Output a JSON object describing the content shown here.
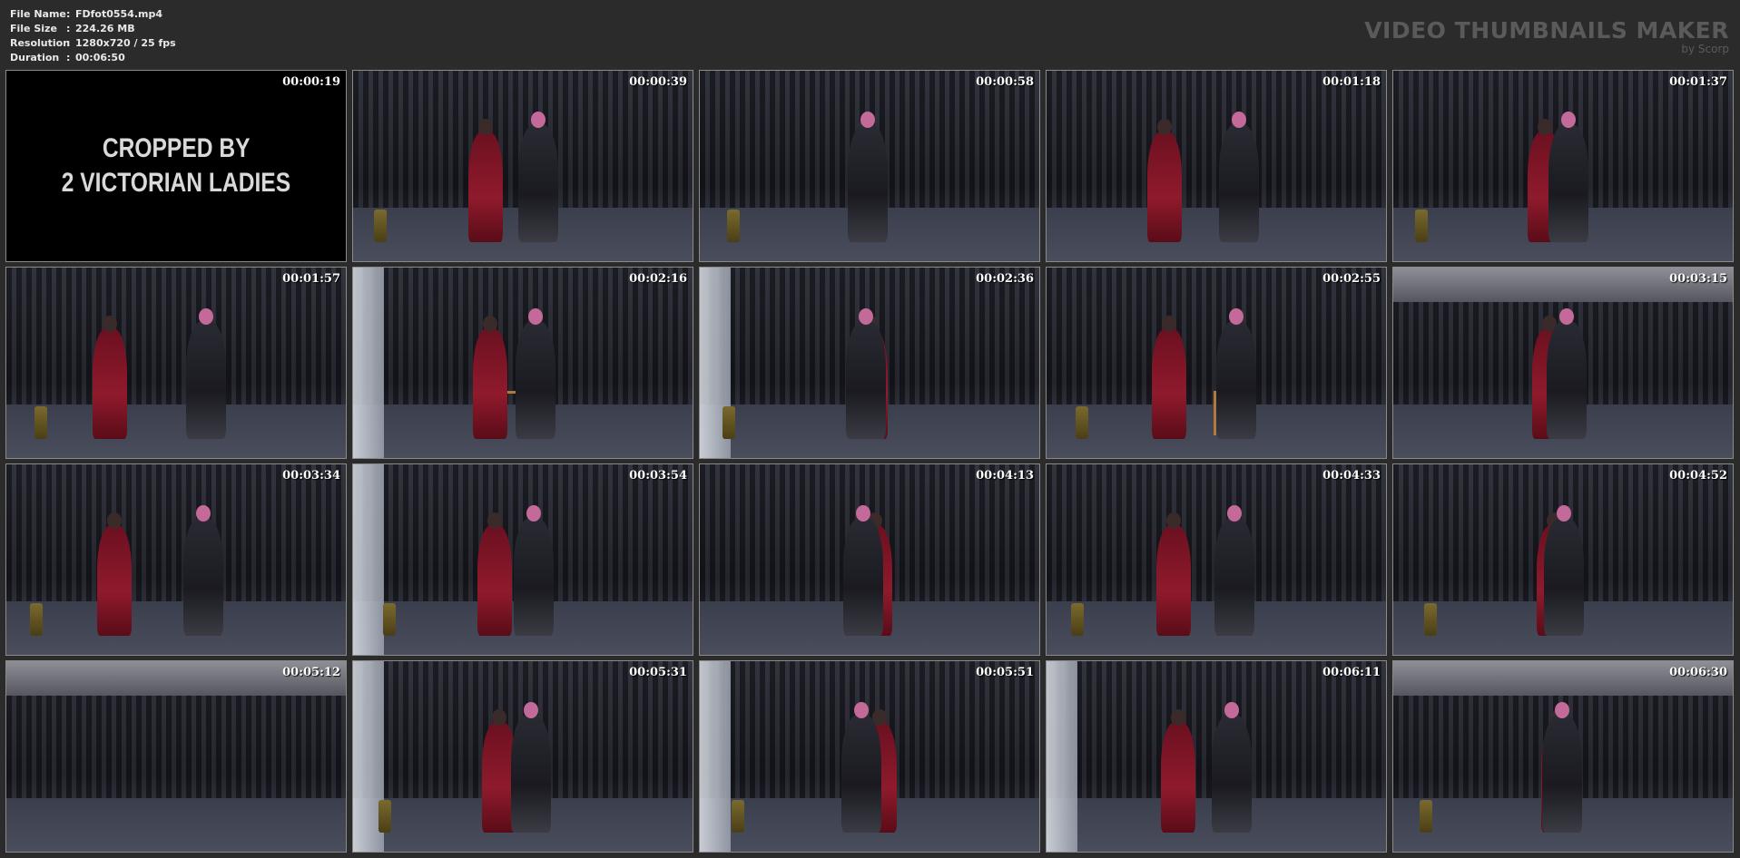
{
  "file_info": {
    "rows": [
      {
        "label": "File Name",
        "sep": ":",
        "value": "FDfot0554.mp4"
      },
      {
        "label": "File Size",
        "sep": ":",
        "value": "224.26 MB"
      },
      {
        "label": "Resolution",
        "sep": ":",
        "value": "1280x720 / 25 fps"
      },
      {
        "label": "Duration",
        "sep": ":",
        "value": "00:06:50"
      }
    ]
  },
  "brand": {
    "title": "VIDEO THUMBNAILS MAKER",
    "subtitle": "by Scorp"
  },
  "title_card": {
    "line1": "CROPPED BY",
    "line2": "2 VICTORIAN LADIES"
  },
  "thumbnails": [
    {
      "time": "00:00:19",
      "scene": "title"
    },
    {
      "time": "00:00:39",
      "scene": "two-wide"
    },
    {
      "time": "00:00:58",
      "scene": "two-close"
    },
    {
      "time": "00:01:18",
      "scene": "two-wide"
    },
    {
      "time": "00:01:37",
      "scene": "two-wide"
    },
    {
      "time": "00:01:57",
      "scene": "two-wide"
    },
    {
      "time": "00:02:16",
      "scene": "window-chair"
    },
    {
      "time": "00:02:36",
      "scene": "window-chair"
    },
    {
      "time": "00:02:55",
      "scene": "chair"
    },
    {
      "time": "00:03:15",
      "scene": "ceiling"
    },
    {
      "time": "00:03:34",
      "scene": "two-wide"
    },
    {
      "time": "00:03:54",
      "scene": "closeup-window"
    },
    {
      "time": "00:04:13",
      "scene": "low-chair"
    },
    {
      "time": "00:04:33",
      "scene": "chair"
    },
    {
      "time": "00:04:52",
      "scene": "two-wide"
    },
    {
      "time": "00:05:12",
      "scene": "ceiling-empty"
    },
    {
      "time": "00:05:31",
      "scene": "closeup-window"
    },
    {
      "time": "00:05:51",
      "scene": "window-chair"
    },
    {
      "time": "00:06:11",
      "scene": "window-chair"
    },
    {
      "time": "00:06:30",
      "scene": "ceiling"
    }
  ],
  "colors": {
    "background": "#2b2b2b",
    "border": "#8a8a8a",
    "brand_text": "#5a5a5a",
    "info_text": "#e9e9e9"
  }
}
